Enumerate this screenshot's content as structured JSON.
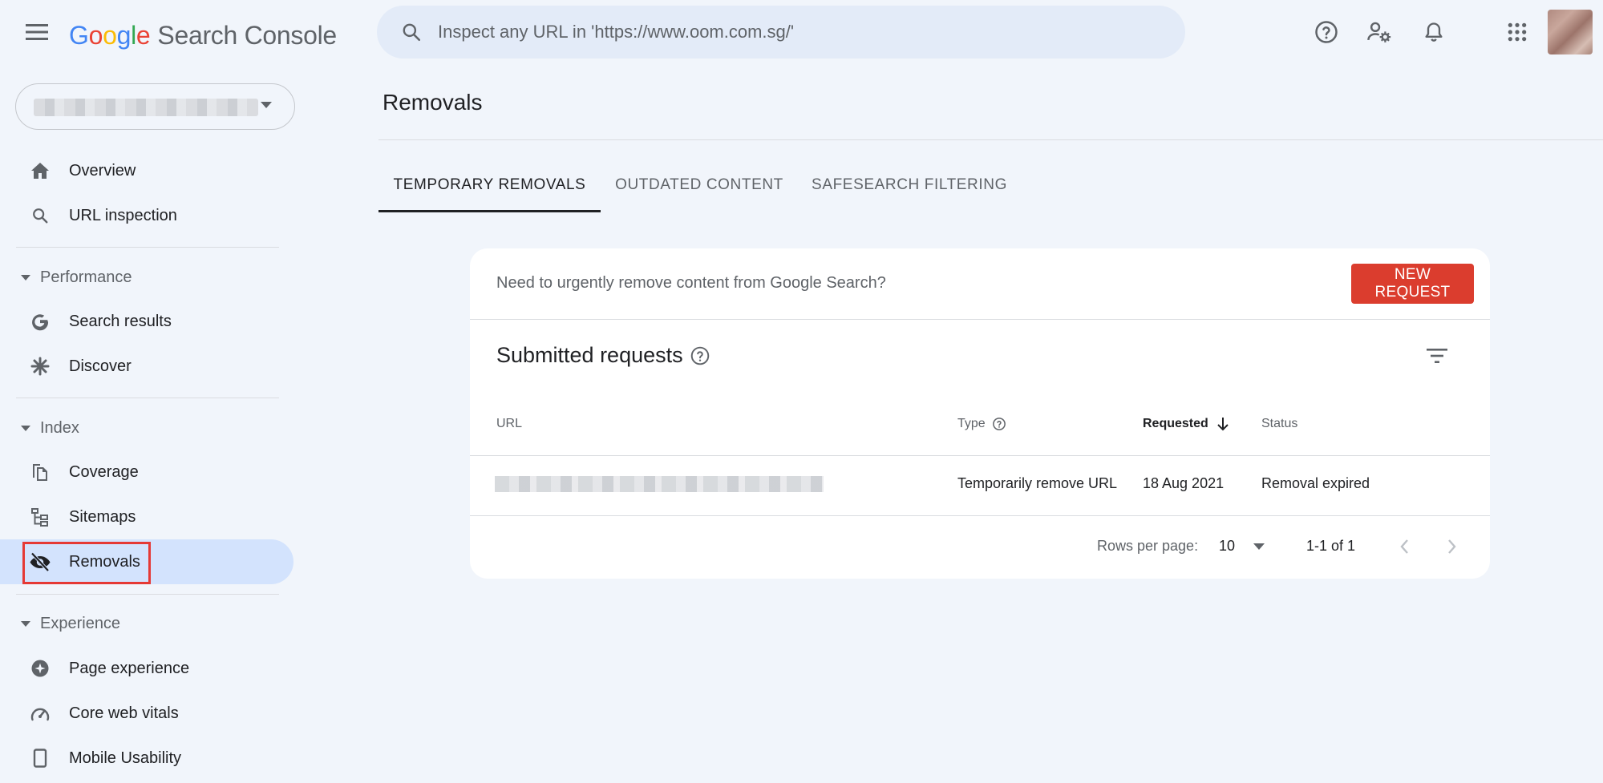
{
  "header": {
    "logo": {
      "letters": [
        "G",
        "o",
        "o",
        "g",
        "l",
        "e"
      ],
      "product": "Search Console"
    },
    "search": {
      "placeholder": "Inspect any URL in 'https://www.oom.com.sg/'"
    },
    "icons": [
      "help-icon",
      "manage-users-icon",
      "notifications-icon",
      "apps-grid-icon"
    ]
  },
  "sidebar": {
    "items": [
      {
        "label": "Overview",
        "icon": "home-icon"
      },
      {
        "label": "URL inspection",
        "icon": "search-icon"
      }
    ],
    "sections": [
      {
        "label": "Performance",
        "items": [
          {
            "label": "Search results",
            "icon": "google-g-icon"
          },
          {
            "label": "Discover",
            "icon": "asterisk-icon"
          }
        ]
      },
      {
        "label": "Index",
        "items": [
          {
            "label": "Coverage",
            "icon": "coverage-icon"
          },
          {
            "label": "Sitemaps",
            "icon": "sitemap-icon"
          },
          {
            "label": "Removals",
            "icon": "visibility-off-icon",
            "active": true
          }
        ]
      },
      {
        "label": "Experience",
        "items": [
          {
            "label": "Page experience",
            "icon": "page-experience-icon"
          },
          {
            "label": "Core web vitals",
            "icon": "speed-gauge-icon"
          },
          {
            "label": "Mobile Usability",
            "icon": "smartphone-icon"
          }
        ]
      }
    ]
  },
  "main": {
    "title": "Removals",
    "tabs": [
      {
        "label": "TEMPORARY REMOVALS",
        "active": true
      },
      {
        "label": "OUTDATED CONTENT",
        "active": false
      },
      {
        "label": "SAFESEARCH FILTERING",
        "active": false
      }
    ],
    "banner": {
      "text": "Need to urgently remove content from Google Search?",
      "button": "NEW REQUEST"
    },
    "requests": {
      "title": "Submitted requests",
      "columns": [
        "URL",
        "Type",
        "Requested",
        "Status"
      ],
      "rows": [
        {
          "type": "Temporarily remove URL",
          "requested": "18 Aug 2021",
          "status": "Removal expired"
        }
      ]
    },
    "pagination": {
      "rows_label": "Rows per page:",
      "rows_value": "10",
      "range": "1-1 of 1"
    }
  },
  "colors": {
    "background": "#f1f5fb",
    "active_nav": "#d3e3fd",
    "primary_button": "#db3d2e",
    "highlight_box": "#e53935"
  }
}
